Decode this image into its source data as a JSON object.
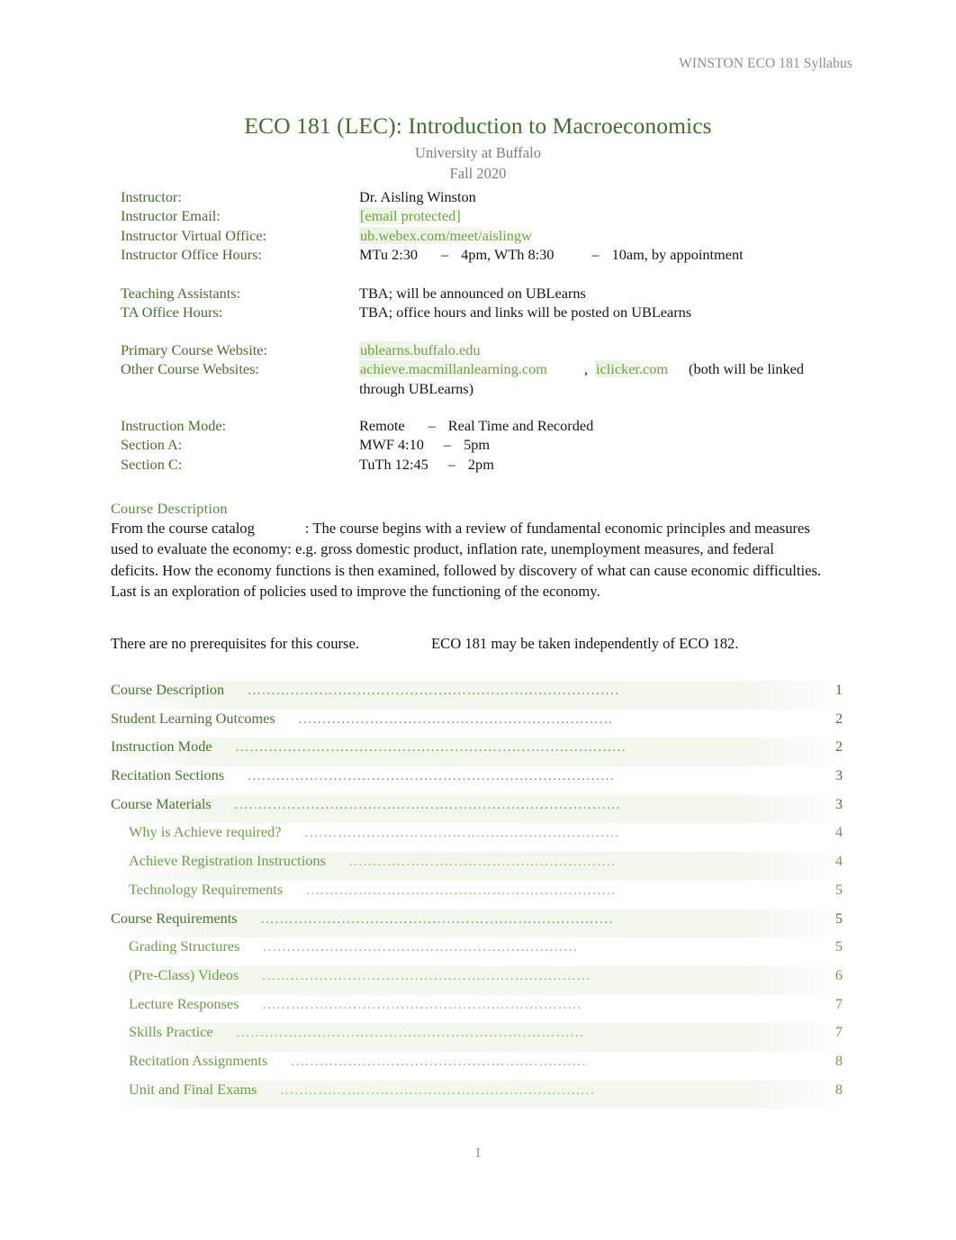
{
  "header": {
    "running_head": "WINSTON ECO 181 Syllabus"
  },
  "title": {
    "course_title": "ECO 181 (LEC): Introduction to Macroeconomics",
    "institution": "University at Buffalo",
    "term": "Fall 2020"
  },
  "info": {
    "instructor": {
      "label": "Instructor:",
      "value": "Dr. Aisling Winston"
    },
    "instructor_email": {
      "label": "Instructor Email:",
      "value": "[email protected]"
    },
    "instructor_virtual_office": {
      "label": "Instructor Virtual Office:",
      "value": "ub.webex.com/meet/aislingw"
    },
    "instructor_office_hours": {
      "label": "Instructor Office Hours:",
      "part1": "MTu 2:30",
      "dash1": "–",
      "part2": "4pm, WTh 8:30",
      "dash2": "–",
      "part3": "10am, by appointment"
    },
    "teaching_assistants": {
      "label": "Teaching Assistants:",
      "value": "TBA; will be announced on UBLearns"
    },
    "ta_office_hours": {
      "label": "TA Office Hours:",
      "value": "TBA; office hours and links will be posted on UBLearns"
    },
    "primary_course_website": {
      "label": "Primary Course Website:",
      "value": "ublearns.buffalo.edu"
    },
    "other_course_websites": {
      "label": "Other Course Websites:",
      "link1": "achieve.macmillanlearning.com",
      "separator": ",",
      "link2": "iclicker.com",
      "note": "(both will be linked through UBLearns)"
    },
    "instruction_mode": {
      "label": "Instruction Mode:",
      "part1": "Remote",
      "dash": "–",
      "part2": "Real Time and Recorded"
    },
    "section_a": {
      "label": "Section A:",
      "part1": "MWF 4:10",
      "dash": "–",
      "part2": "5pm"
    },
    "section_c": {
      "label": "Section C:",
      "part1": "TuTh 12:45",
      "dash": "–",
      "part2": "2pm"
    }
  },
  "course_description": {
    "heading": "Course Description",
    "catalog_lead": "From the course catalog",
    "catalog_body": ": The course begins with a review of fundamental economic principles and measures used to evaluate the economy: e.g. gross domestic product, inflation rate, unemployment measures, and federal deficits. How the economy functions is then examined, followed by discovery of what can cause economic difficulties. Last is an exploration of policies used to improve the functioning of the economy.",
    "prereq_lead": "There are no prerequisites for this course.",
    "prereq_body": "ECO 181 may be taken independently of ECO 182."
  },
  "toc": {
    "entries": [
      {
        "label": "Course Description",
        "page": "1",
        "level": 1,
        "dots": 78
      },
      {
        "label": "Student Learning Outcomes",
        "page": "2",
        "level": 1,
        "dots": 66
      },
      {
        "label": "Instruction Mode",
        "page": "2",
        "level": 1,
        "dots": 82
      },
      {
        "label": "Recitation Sections",
        "page": "3",
        "level": 1,
        "dots": 77
      },
      {
        "label": "Course Materials",
        "page": "3",
        "level": 1,
        "dots": 81
      },
      {
        "label": "Why is Achieve required?",
        "page": "4",
        "level": 2,
        "dots": 66
      },
      {
        "label": "Achieve Registration Instructions",
        "page": "4",
        "level": 2,
        "dots": 56
      },
      {
        "label": "Technology Requirements",
        "page": "5",
        "level": 2,
        "dots": 65
      },
      {
        "label": "Course Requirements",
        "page": "5",
        "level": 1,
        "dots": 74
      },
      {
        "label": "Grading Structures",
        "page": "5",
        "level": 2,
        "dots": 66
      },
      {
        "label": "(Pre-Class) Videos",
        "page": "6",
        "level": 2,
        "dots": 69
      },
      {
        "label": "Lecture Responses",
        "page": "7",
        "level": 2,
        "dots": 67
      },
      {
        "label": "Skills Practice",
        "page": "7",
        "level": 2,
        "dots": 73
      },
      {
        "label": "Recitation Assignments",
        "page": "8",
        "level": 2,
        "dots": 62
      },
      {
        "label": "Unit and Final Exams",
        "page": "8",
        "level": 2,
        "dots": 66
      }
    ]
  },
  "footer": {
    "page_number": "1"
  },
  "colors": {
    "title_green": "#3f7029",
    "label_green": "#44702c",
    "link_green": "#6fa243",
    "toc_level1_green": "#47762e",
    "toc_level2_green": "#6aa046",
    "muted_gray": "#8d8d8d",
    "body_black": "#161616"
  }
}
